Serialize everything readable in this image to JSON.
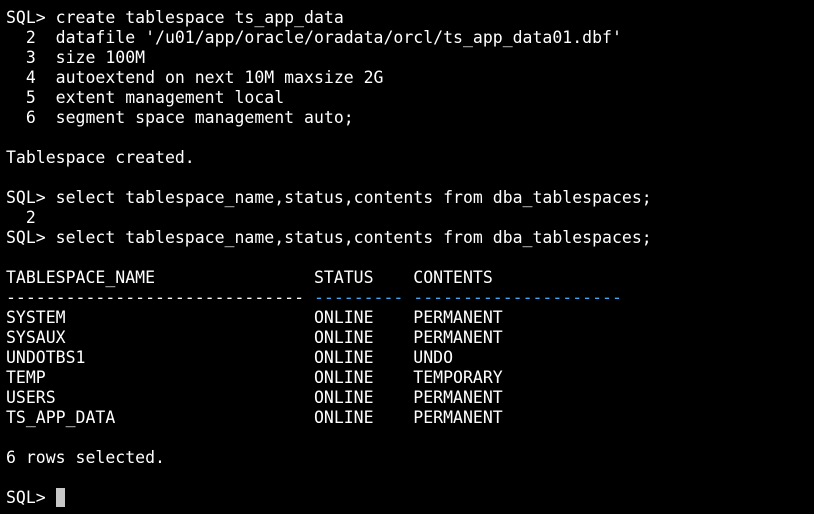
{
  "terminal": {
    "colors": {
      "background": "#000000",
      "text": "#ffffff",
      "header_underline_accent": "#3fa9f5",
      "cursor": "#c8c8c8"
    },
    "create_statement": [
      "SQL> create tablespace ts_app_data",
      "  2  datafile '/u01/app/oracle/oradata/orcl/ts_app_data01.dbf'",
      "  3  size 100M",
      "  4  autoextend on next 10M maxsize 2G",
      "  5  extent management local",
      "  6  segment space management auto;"
    ],
    "create_result": "Tablespace created.",
    "select_attempt_1": [
      "SQL> select tablespace_name,status,contents from dba_tablespaces;",
      "  2"
    ],
    "select_attempt_2": "SQL> select tablespace_name,status,contents from dba_tablespaces;",
    "result_table": {
      "header_line": "TABLESPACE_NAME                STATUS    CONTENTS",
      "underline": {
        "col1": "------------------------------",
        "col2": "---------",
        "col3": "---------------------"
      },
      "rows": [
        "SYSTEM                         ONLINE    PERMANENT",
        "SYSAUX                         ONLINE    PERMANENT",
        "UNDOTBS1                       ONLINE    UNDO",
        "TEMP                           ONLINE    TEMPORARY",
        "USERS                          ONLINE    PERMANENT",
        "TS_APP_DATA                    ONLINE    PERMANENT"
      ]
    },
    "rows_selected": "6 rows selected.",
    "prompt": "SQL> "
  }
}
